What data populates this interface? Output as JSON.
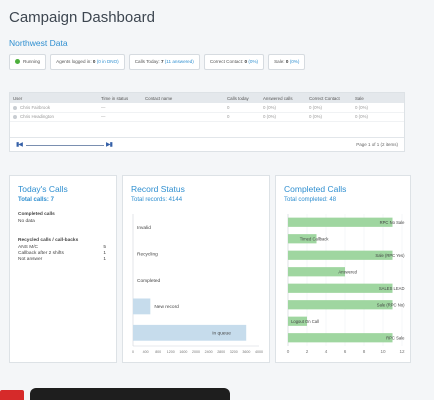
{
  "page": {
    "title": "Campaign Dashboard",
    "subtitle": "Northwest Data"
  },
  "statusbar": {
    "running": "Running",
    "agents_label": "Agents logged in:",
    "agents_value": "0",
    "agents_detail": "(0 in DNO)",
    "calls_label": "Calls Today:",
    "calls_value": "7",
    "calls_detail": "(11 answered)",
    "contact_label": "Correct Contact:",
    "contact_value": "0",
    "contact_detail": "(0%)",
    "sale_label": "Sale:",
    "sale_value": "0",
    "sale_detail": "(0%)"
  },
  "agents_table": {
    "columns": [
      "User",
      "Time in status",
      "Contact name",
      "Calls today",
      "Answered calls",
      "Correct Contact",
      "Sale"
    ],
    "rows": [
      [
        "Chris Fairbrook",
        "—",
        "",
        "0",
        "0  (0%)",
        "0  (0%)",
        "0  (0%)"
      ],
      [
        "Chris Headington",
        "—",
        "",
        "0",
        "0  (0%)",
        "0  (0%)",
        "0  (0%)"
      ]
    ],
    "pager_first": "▮◀",
    "pager_last": "▶▮",
    "pager_info": "Page 1 of 1 (2 items)"
  },
  "today": {
    "title": "Today's Calls",
    "total": "Total calls: 7",
    "completed_heading": "Completed calls",
    "completed_value": "No data",
    "recycled_heading": "Recycled calls / call-backs",
    "recycled": [
      {
        "label": "ANS M/C",
        "value": "5"
      },
      {
        "label": "Callback after 2 shifts",
        "value": "1"
      },
      {
        "label": "Not answer",
        "value": "1"
      }
    ]
  },
  "record": {
    "title": "Record Status",
    "total": "Total records: 4144",
    "chart_data": {
      "type": "bar",
      "orientation": "horizontal",
      "categories": [
        "Invalid",
        "Recycling",
        "Completed",
        "New record",
        "In queue"
      ],
      "values": [
        0,
        0,
        0,
        550,
        3594
      ],
      "xlim": [
        0,
        4000
      ],
      "xticks": [
        "0",
        "400",
        "800",
        "1200",
        "1600",
        "2000",
        "2400",
        "2800",
        "3200",
        "3600",
        "4000"
      ],
      "bar_color": "#c6dcec"
    }
  },
  "completed": {
    "title": "Completed Calls",
    "total": "Total completed: 48",
    "chart_data": {
      "type": "bar",
      "orientation": "horizontal",
      "categories": [
        "RPC No Sale",
        "Timed Callback",
        "Sale (RPC Yes)",
        "Answered",
        "SALES LEAD",
        "Sale (RPC No)",
        "Logout On Call",
        "RPC Sale"
      ],
      "values": [
        11,
        3,
        11,
        6,
        11,
        11,
        2,
        11
      ],
      "xlim": [
        0,
        12
      ],
      "xticks": [
        "0",
        "2",
        "4",
        "6",
        "8",
        "10",
        "12"
      ],
      "bar_color": "#9fd6a0"
    }
  }
}
